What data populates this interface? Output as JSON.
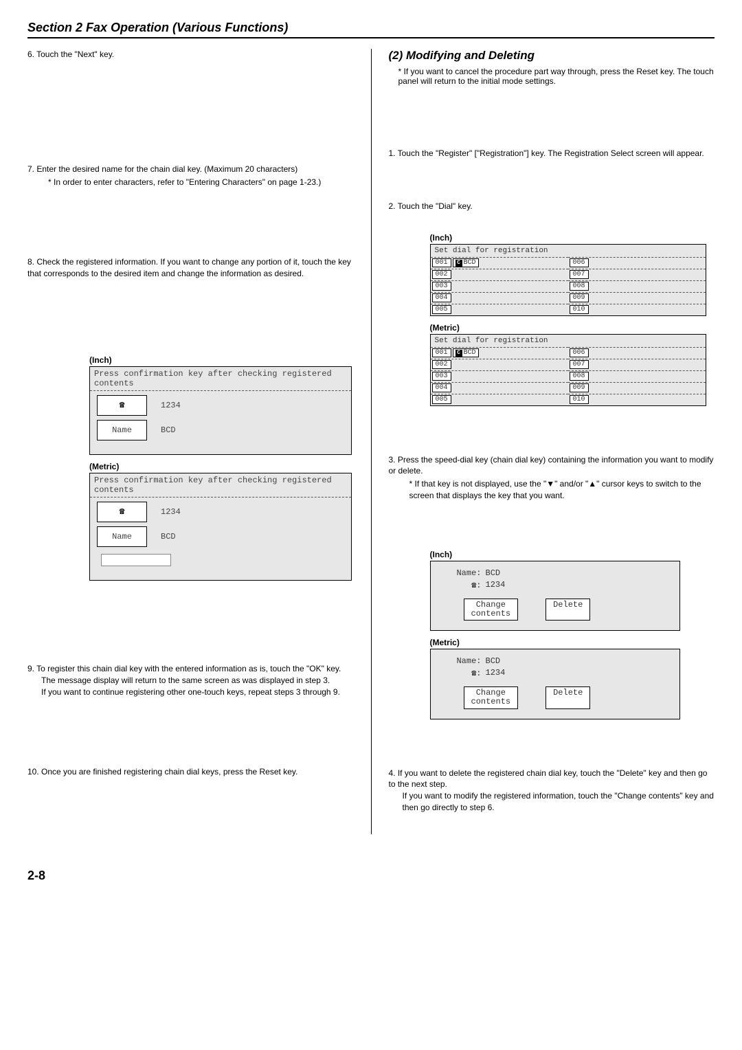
{
  "sectionTitle": "Section 2  Fax Operation (Various Functions)",
  "left": {
    "step6": "6. Touch the \"Next\" key.",
    "step7": "7. Enter the desired name for the chain dial key. (Maximum 20 characters)",
    "step7note": "* In order to enter characters, refer to \"Entering Characters\" on page 1-23.)",
    "step8": "8. Check the registered information. If you want to change any portion of it, touch the key that corresponds to the desired item and change the information as desired.",
    "inchLabel": "(Inch)",
    "metricLabel": "(Metric)",
    "lcdConfirmBar": "Press confirmation key after checking registered contents",
    "lcdNameBtn": "Name",
    "lcdVal1": "1234",
    "lcdVal2": "BCD",
    "step9a": "9. To register this chain dial key with the entered information as is, touch the \"OK\" key.",
    "step9b": "The message display will return to the same screen as was displayed in step 3.",
    "step9c": "If you want to continue registering other one-touch keys, repeat steps 3 through 9.",
    "step10": "10. Once you are finished registering chain dial keys, press the Reset key."
  },
  "right": {
    "heading": "(2) Modifying and Deleting",
    "intro": "* If you want to cancel the procedure part way through, press the Reset key. The touch panel will return to the initial mode settings.",
    "step1": "1. Touch the \"Register\" [\"Registration\"] key. The Registration Select screen will appear.",
    "step2": "2. Touch the \"Dial\" key.",
    "inchLabel": "(Inch)",
    "metricLabel": "(Metric)",
    "regTitle": "Set dial for registration",
    "regLeft": [
      "001",
      "002",
      "003",
      "004",
      "005"
    ],
    "regRight": [
      "006",
      "007",
      "008",
      "009",
      "010"
    ],
    "regEntry": "BCD",
    "step3": "3. Press the speed-dial key (chain dial key) containing the information you want to modify or delete.",
    "step3note": "* If that key is not displayed, use the \"▼\" and/or \"▲\" cursor keys to switch to the screen that displays the key that you want.",
    "modNameLabel": "Name:",
    "modName": "BCD",
    "modTel": "1234",
    "btnChange": "Change\ncontents",
    "btnDelete": "Delete",
    "step4a": "4. If you want to delete the registered chain dial key, touch the \"Delete\" key and then go to the next step.",
    "step4b": "If you want to modify the registered information, touch the \"Change contents\" key and then go directly to step 6."
  },
  "pageNumber": "2-8"
}
